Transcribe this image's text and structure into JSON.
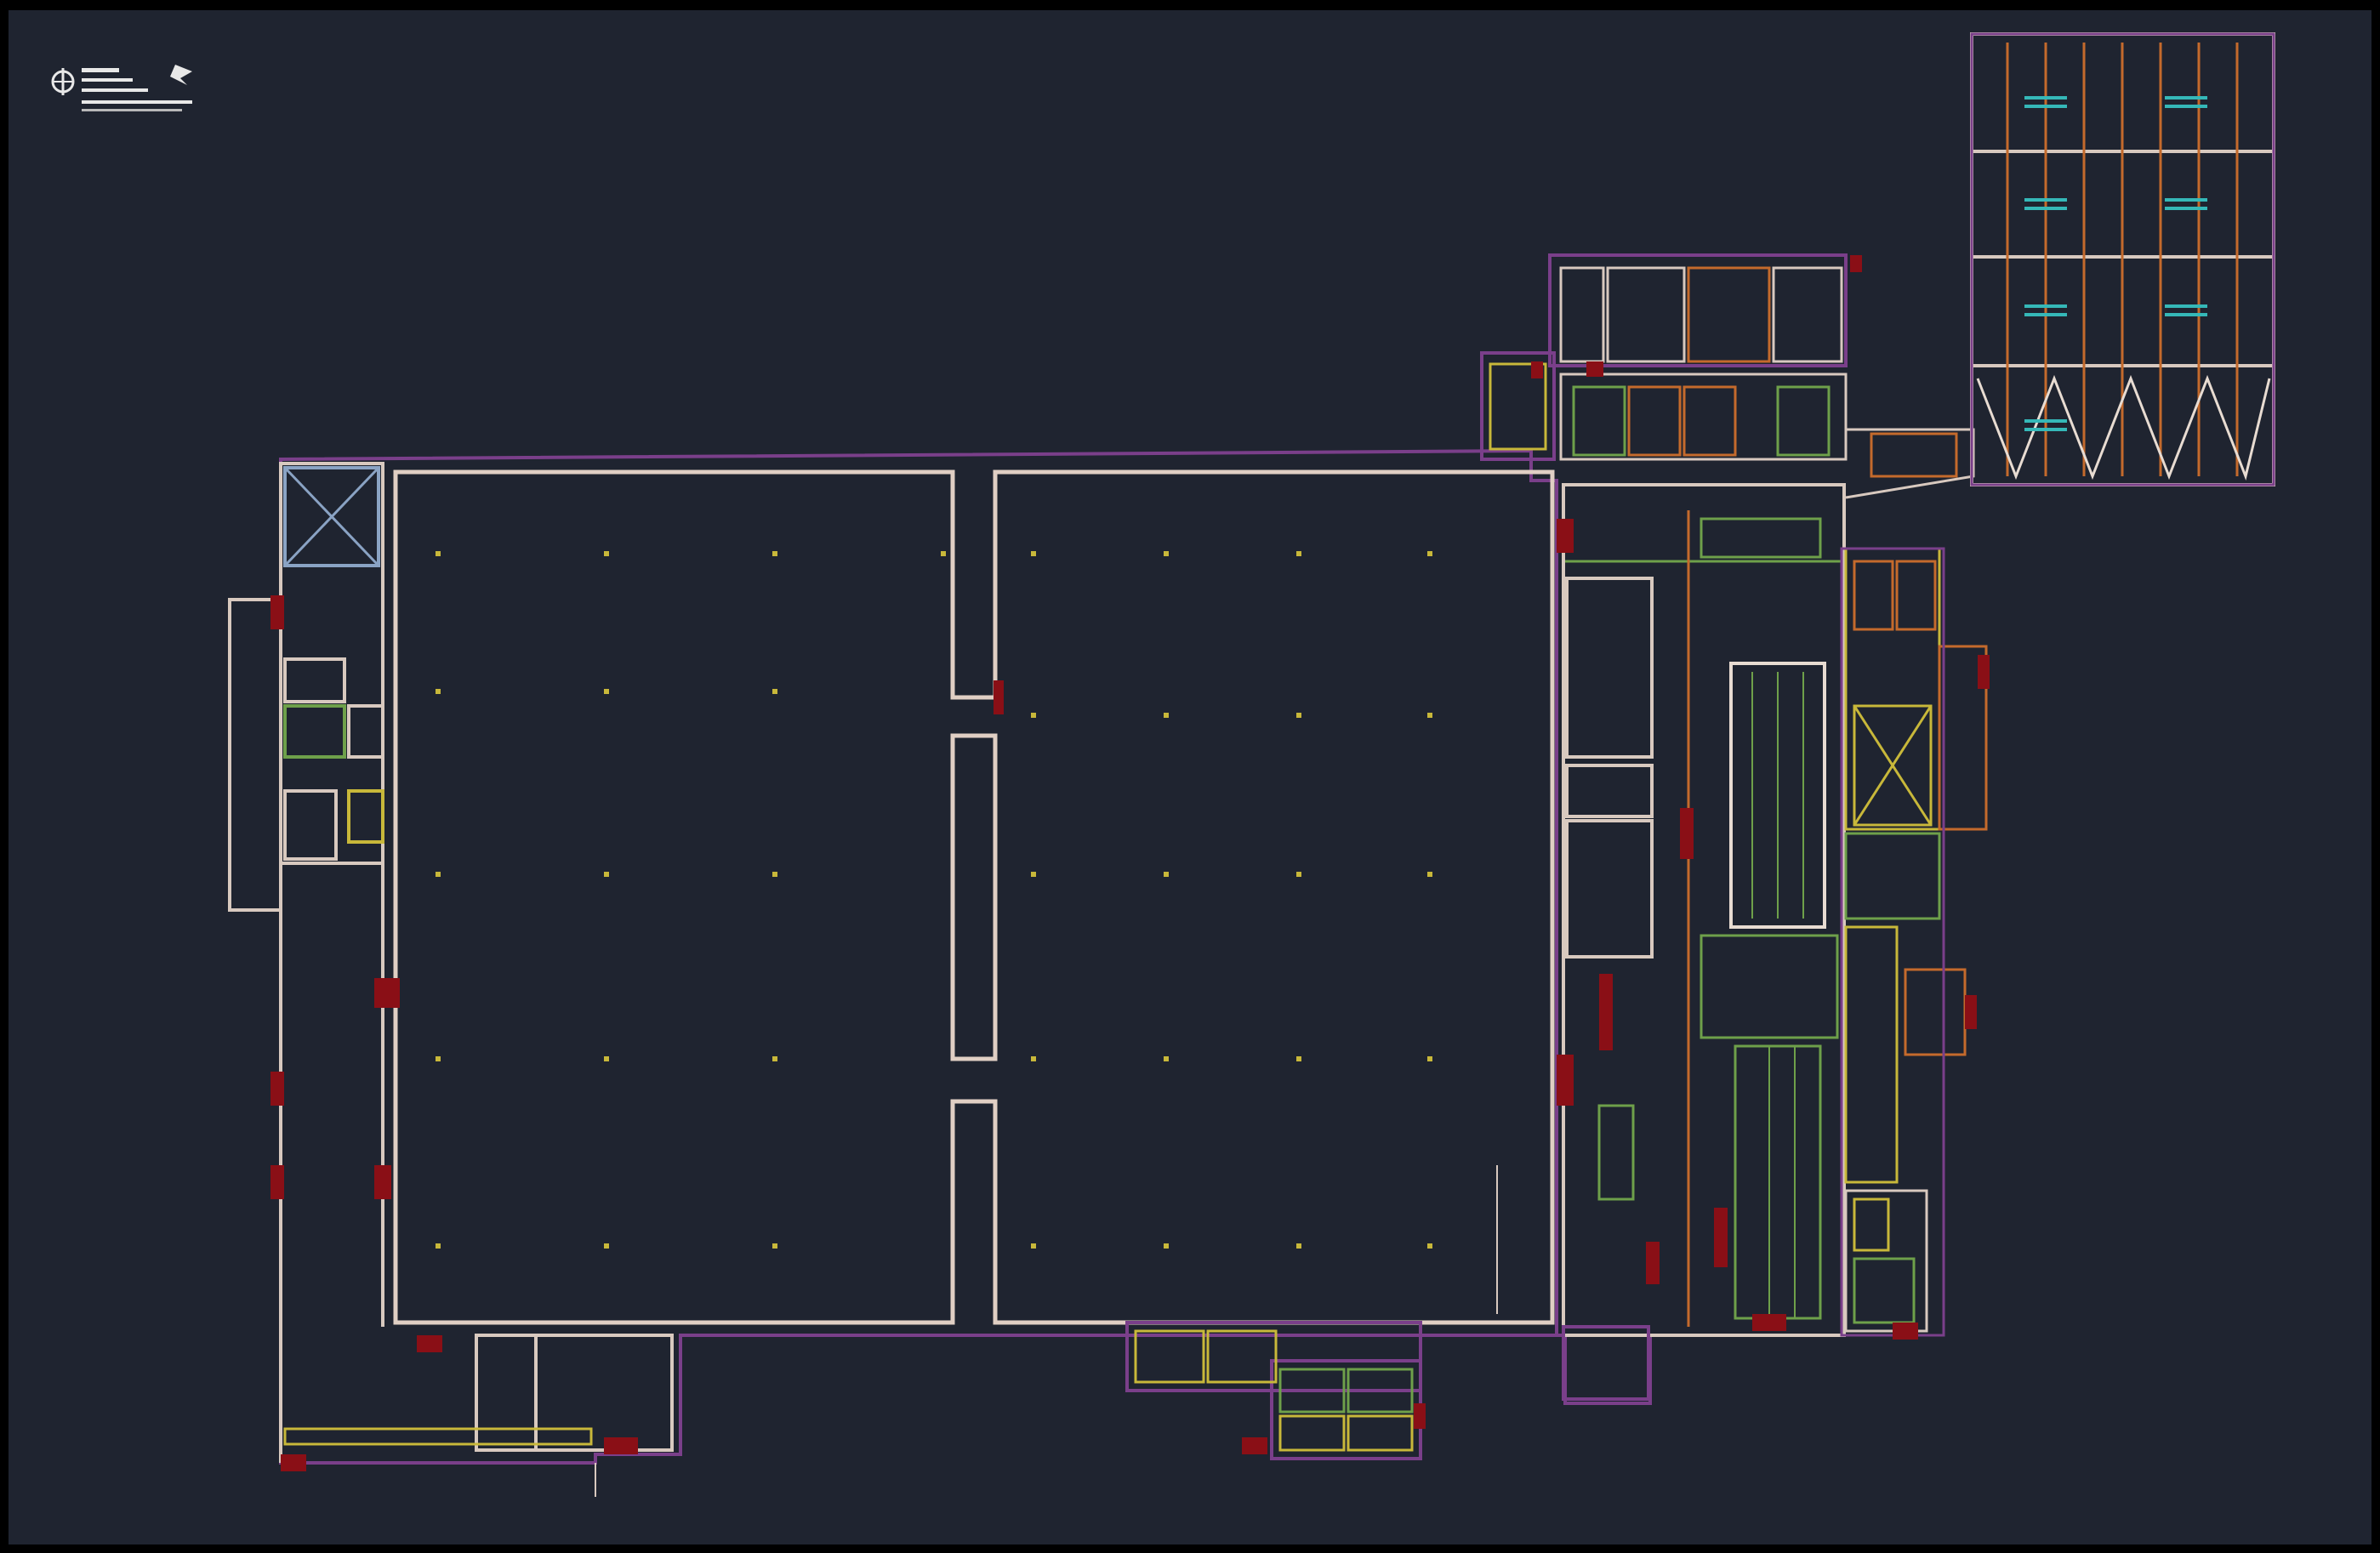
{
  "title_block": {
    "lines": [
      "",
      "",
      "",
      ""
    ]
  },
  "colors": {
    "frame": "#000000",
    "background": "#1f2430",
    "outer_wall": "#7a3f8a",
    "wall": "#d8c9bf",
    "wall_alt": "#e8dcd2",
    "door": "#8a0f16",
    "partition_green": "#6ea04a",
    "partition_orange": "#c46a2c",
    "yellow": "#c8b83a",
    "cyan": "#35b8b8",
    "blue_grey": "#8aa3c4",
    "text": "#e8e8e8"
  },
  "icons": {
    "title_block_logo": "compass-logo-icon",
    "north_arrow": "north-arrow-icon"
  }
}
